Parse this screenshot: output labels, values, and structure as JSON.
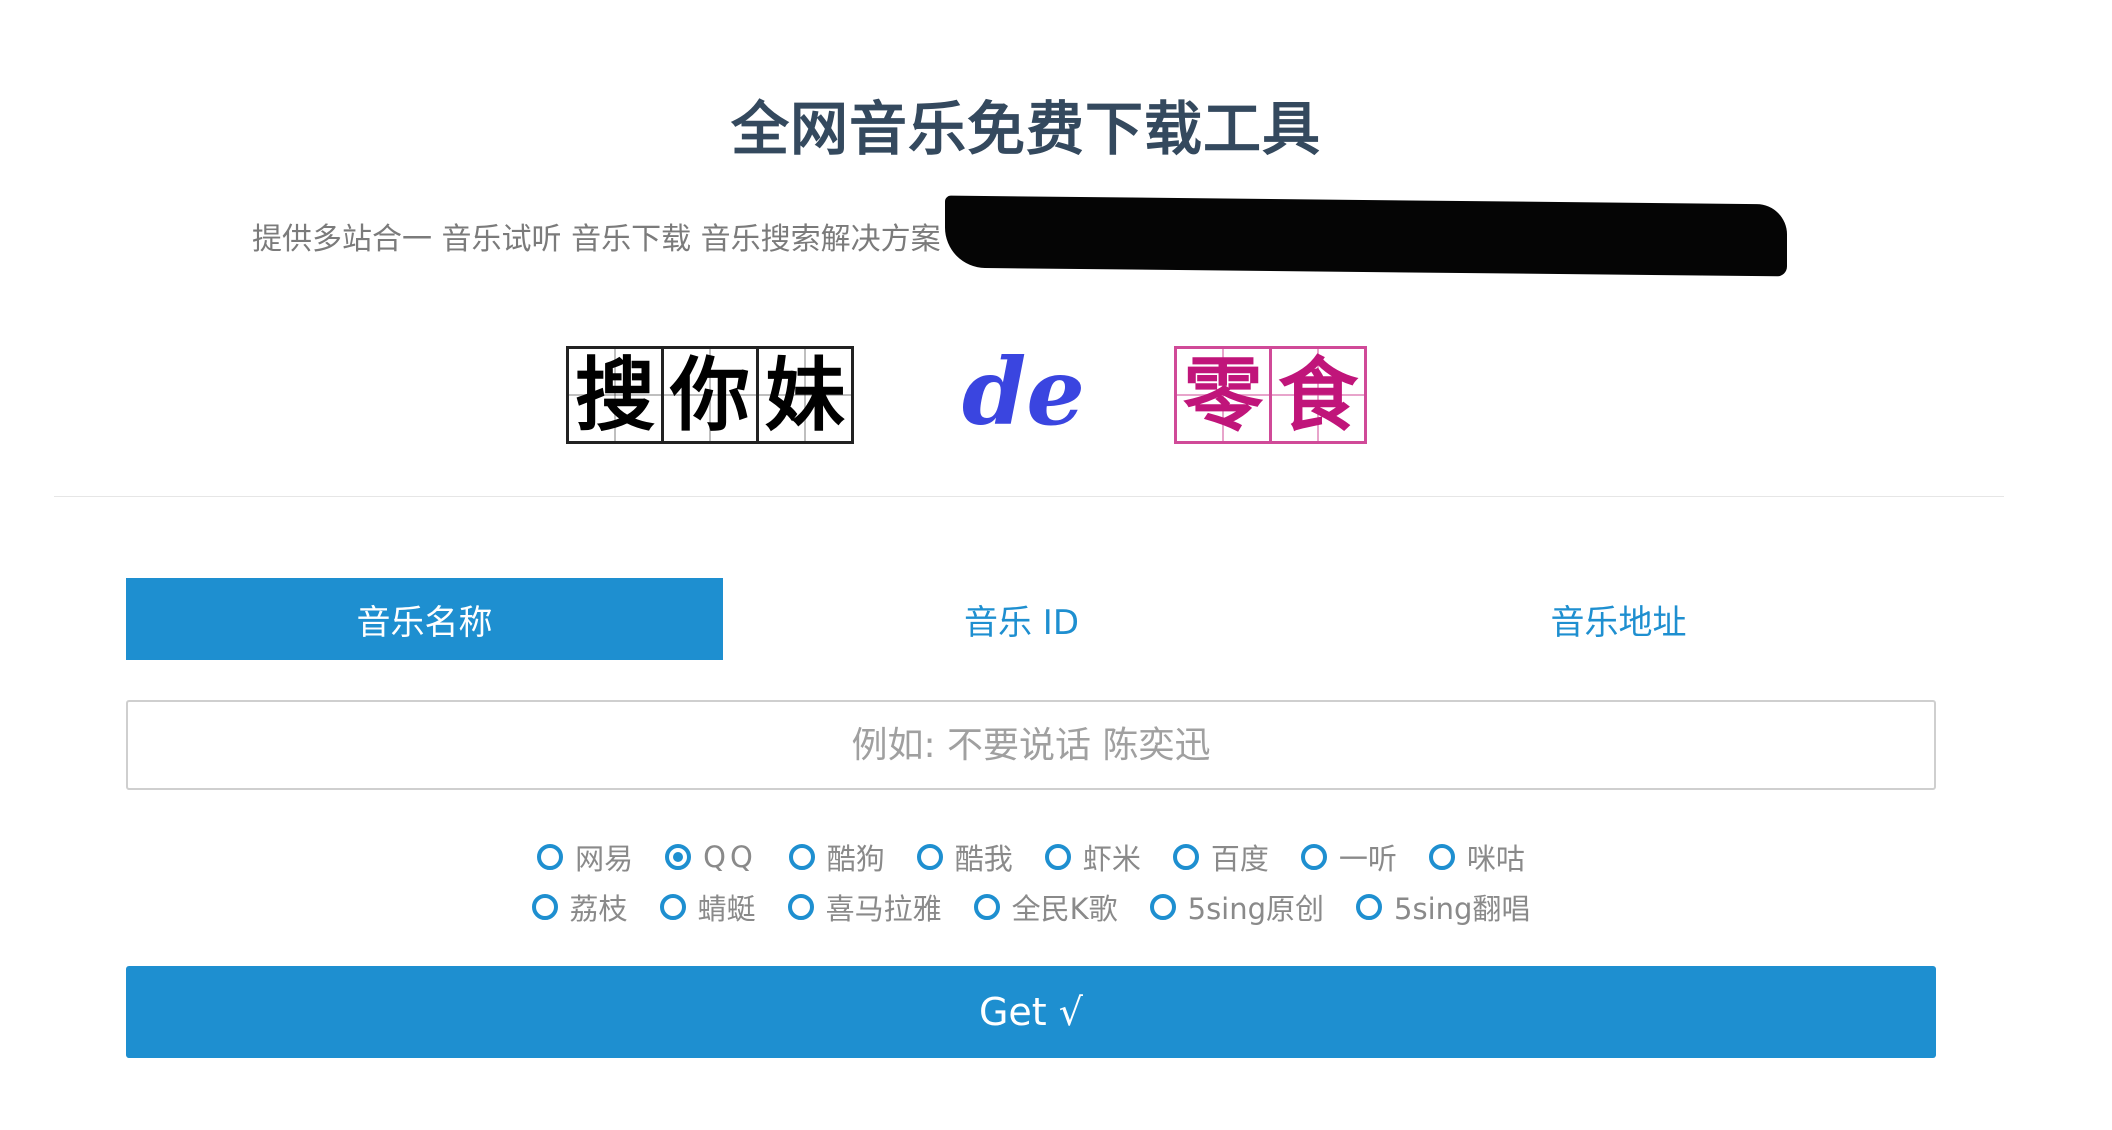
{
  "header": {
    "title": "全网音乐免费下载工具",
    "subtitle": "提供多站合一 音乐试听 音乐下载 音乐搜索解决方案"
  },
  "logo": {
    "part1": [
      "搜",
      "你",
      "妹"
    ],
    "part2": "de",
    "part3": [
      "零",
      "食"
    ]
  },
  "tabs": [
    {
      "label": "音乐名称",
      "active": true
    },
    {
      "label": "音乐 ID",
      "active": false
    },
    {
      "label": "音乐地址",
      "active": false
    }
  ],
  "search": {
    "placeholder": "例如: 不要说话 陈奕迅",
    "value": ""
  },
  "sources_row1": [
    {
      "label": "网易",
      "selected": false
    },
    {
      "label": "QQ",
      "selected": true
    },
    {
      "label": "酷狗",
      "selected": false
    },
    {
      "label": "酷我",
      "selected": false
    },
    {
      "label": "虾米",
      "selected": false
    },
    {
      "label": "百度",
      "selected": false
    },
    {
      "label": "一听",
      "selected": false
    },
    {
      "label": "咪咕",
      "selected": false
    }
  ],
  "sources_row2": [
    {
      "label": "荔枝",
      "selected": false
    },
    {
      "label": "蜻蜓",
      "selected": false
    },
    {
      "label": "喜马拉雅",
      "selected": false
    },
    {
      "label": "全民K歌",
      "selected": false
    },
    {
      "label": "5sing原创",
      "selected": false
    },
    {
      "label": "5sing翻唱",
      "selected": false
    }
  ],
  "submit": {
    "label": "Get √"
  },
  "colors": {
    "accent": "#1e8fd0",
    "title": "#34495e",
    "logo_pink": "#c0157a",
    "logo_blue": "#3a45e0"
  }
}
